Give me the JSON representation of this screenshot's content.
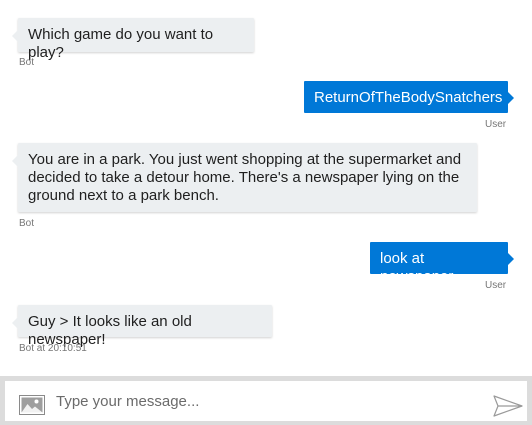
{
  "messages": [
    {
      "from": "bot",
      "text": "Which game do you want to play?",
      "meta": "Bot"
    },
    {
      "from": "user",
      "text": "ReturnOfTheBodySnatchers",
      "meta": "User"
    },
    {
      "from": "bot",
      "text": "You are in a park. You just went shopping at the supermarket and decided to take a detour home. There's a newspaper lying on the ground next to a park bench.",
      "meta": "Bot"
    },
    {
      "from": "user",
      "text": "look at newspaper",
      "meta": "User"
    },
    {
      "from": "bot",
      "text": "Guy > It looks like an old newspaper!",
      "meta": "Bot at 20:10:51"
    }
  ],
  "composer": {
    "placeholder": "Type your message...",
    "value": "",
    "image_icon": "image-upload-icon",
    "send_icon": "send-icon"
  },
  "colors": {
    "bot_bubble": "#eceff1",
    "user_bubble": "#0078d7",
    "input_frame": "#dcdcdc"
  }
}
